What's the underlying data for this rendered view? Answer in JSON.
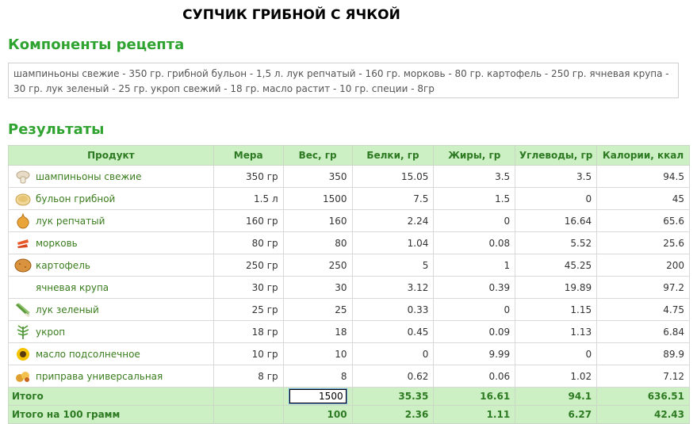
{
  "title": "СУПЧИК ГРИБНОЙ С ЯЧКОЙ",
  "components_heading": "Компоненты рецепта",
  "components_text": "шампиньоны свежие - 350 гр. грибной бульон - 1,5 л. лук репчатый - 160 гр. морковь - 80 гр. картофель - 250 гр. ячневая крупа - 30 гр. лук зеленый - 25 гр. укроп свежий - 18 гр. масло растит - 10 гр. специи - 8гр",
  "results_heading": "Результаты",
  "colors": {
    "heading": "#2fa32f",
    "header_bg": "#ccf0c4",
    "header_text": "#2d7a22",
    "product_link": "#3a7d1e"
  },
  "columns": [
    "Продукт",
    "Мера",
    "Вес, гр",
    "Белки, гр",
    "Жиры, гр",
    "Углеводы, гр",
    "Калории, ккал"
  ],
  "rows": [
    {
      "icon": "mushroom-icon",
      "name": "шампиньоны свежие",
      "measure": "350 гр",
      "weight": "350",
      "protein": "15.05",
      "fat": "3.5",
      "carbs": "3.5",
      "kcal": "94.5"
    },
    {
      "icon": "broth-icon",
      "name": "бульон грибной",
      "measure": "1.5 л",
      "weight": "1500",
      "protein": "7.5",
      "fat": "1.5",
      "carbs": "0",
      "kcal": "45"
    },
    {
      "icon": "onion-icon",
      "name": "лук репчатый",
      "measure": "160 гр",
      "weight": "160",
      "protein": "2.24",
      "fat": "0",
      "carbs": "16.64",
      "kcal": "65.6"
    },
    {
      "icon": "carrot-icon",
      "name": "морковь",
      "measure": "80 гр",
      "weight": "80",
      "protein": "1.04",
      "fat": "0.08",
      "carbs": "5.52",
      "kcal": "25.6"
    },
    {
      "icon": "potato-icon",
      "name": "картофель",
      "measure": "250 гр",
      "weight": "250",
      "protein": "5",
      "fat": "1",
      "carbs": "45.25",
      "kcal": "200"
    },
    {
      "icon": "",
      "name": "ячневая крупа",
      "measure": "30 гр",
      "weight": "30",
      "protein": "3.12",
      "fat": "0.39",
      "carbs": "19.89",
      "kcal": "97.2"
    },
    {
      "icon": "green-onion-icon",
      "name": "лук зеленый",
      "measure": "25 гр",
      "weight": "25",
      "protein": "0.33",
      "fat": "0",
      "carbs": "1.15",
      "kcal": "4.75"
    },
    {
      "icon": "dill-icon",
      "name": "укроп",
      "measure": "18 гр",
      "weight": "18",
      "protein": "0.45",
      "fat": "0.09",
      "carbs": "1.13",
      "kcal": "6.84"
    },
    {
      "icon": "sunflower-oil-icon",
      "name": "масло подсолнечное",
      "measure": "10 гр",
      "weight": "10",
      "protein": "0",
      "fat": "9.99",
      "carbs": "0",
      "kcal": "89.9"
    },
    {
      "icon": "spices-icon",
      "name": "приправа универсальная",
      "measure": "8 гр",
      "weight": "8",
      "protein": "0.62",
      "fat": "0.06",
      "carbs": "1.02",
      "kcal": "7.12"
    }
  ],
  "total": {
    "label": "Итого",
    "weight_value": "1500",
    "protein": "35.35",
    "fat": "16.61",
    "carbs": "94.1",
    "kcal": "636.51"
  },
  "per100": {
    "label": "Итого на 100 грамм",
    "weight": "100",
    "protein": "2.36",
    "fat": "1.11",
    "carbs": "6.27",
    "kcal": "42.43"
  }
}
